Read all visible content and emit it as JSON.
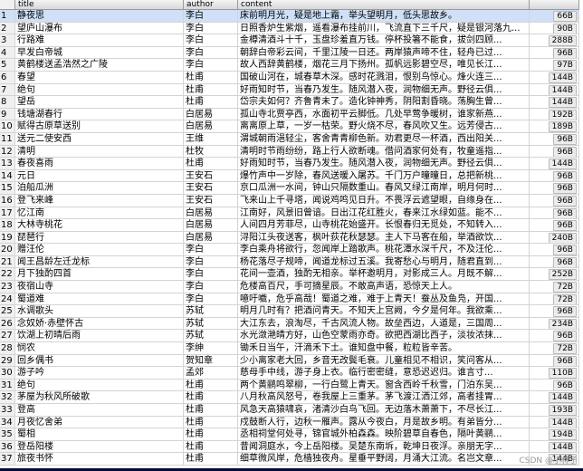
{
  "columns": {
    "title": "title",
    "author": "author",
    "content": "content"
  },
  "rows": [
    {
      "n": "1",
      "title": "静夜思",
      "author": "李白",
      "content": "床前明月光，疑是地上霜，举头望明月，低头思故乡。",
      "size": "66B"
    },
    {
      "n": "2",
      "title": "望庐山瀑布",
      "author": "李白",
      "content": "日照香炉生紫烟，遥看瀑布挂前川，飞流直下三千尺，疑是银河落九...",
      "size": "90B"
    },
    {
      "n": "3",
      "title": "行路难",
      "author": "李白",
      "content": "金樽清酒斗十千，玉盘珍羞直万钱。停杯投箸不能食，拔剑四顾...",
      "size": "288B"
    },
    {
      "n": "4",
      "title": "早发白帝城",
      "author": "李白",
      "content": "朝辞白帝彩云间，千里江陵一日还。两岸猿声啼不住，轻舟已过...",
      "size": "96B"
    },
    {
      "n": "5",
      "title": "黄鹤楼送孟浩然之广陵",
      "author": "李白",
      "content": "故人西辞黄鹤楼，烟花三月下扬州。孤帆远影碧空尽，唯见长江...",
      "size": "97B"
    },
    {
      "n": "6",
      "title": "春望",
      "author": "杜甫",
      "content": "国破山河在，城春草木深。感时花溅泪，恨别鸟惊心。烽火连三...",
      "size": "144B"
    },
    {
      "n": "7",
      "title": "绝句",
      "author": "杜甫",
      "content": "好雨知时节，当春乃发生。随风潜入夜，润物细无声。野径云俱...",
      "size": "144B"
    },
    {
      "n": "8",
      "title": "望岳",
      "author": "杜甫",
      "content": "岱宗夫如何？齐鲁青未了。造化钟神秀，阴阳割昏晓。荡胸生曾...",
      "size": "144B"
    },
    {
      "n": "9",
      "title": "钱塘湖春行",
      "author": "白居易",
      "content": "孤山寺北贾亭西，水面初平云脚低。几处早莺争暖树，谁家新燕...",
      "size": "192B"
    },
    {
      "n": "10",
      "title": "赋得古原草送别",
      "author": "白居易",
      "content": "离离原上草，一岁一枯荣。野火烧不尽，春风吹又生。远芳侵古...",
      "size": "189B"
    },
    {
      "n": "11",
      "title": "送元二使安西",
      "author": "王维",
      "content": "渭城朝雨浥轻尘，客舍青青柳色新。劝君更尽一杯酒，西出阳关...",
      "size": "96B"
    },
    {
      "n": "12",
      "title": "清明",
      "author": "杜牧",
      "content": "清明时节雨纷纷，路上行人欲断魂。借问酒家何处有，牧童遥指...",
      "size": "96B"
    },
    {
      "n": "13",
      "title": "春夜喜雨",
      "author": "杜甫",
      "content": "好雨知时节，当春乃发生。随风潜入夜，润物细无声。野径云俱...",
      "size": "144B"
    },
    {
      "n": "14",
      "title": "元日",
      "author": "王安石",
      "content": "爆竹声中一岁除，春风送暖入屠苏。千门万户曈曈日，总把新桃...",
      "size": "96B"
    },
    {
      "n": "15",
      "title": "泊船瓜洲",
      "author": "王安石",
      "content": "京口瓜洲一水间，钟山只隔数重山。春风又绿江南岸，明月何时...",
      "size": "96B"
    },
    {
      "n": "16",
      "title": "登飞来峰",
      "author": "王安石",
      "content": "飞来山上千寻塔，闻说鸡鸣见日升。不畏浮云遮望眼，自缘身在...",
      "size": "96B"
    },
    {
      "n": "17",
      "title": "忆江南",
      "author": "白居易",
      "content": "江南好，风景旧曾谙。日出江花红胜火，春来江水绿如蓝。能不...",
      "size": "96B"
    },
    {
      "n": "18",
      "title": "大林寺桃花",
      "author": "白居易",
      "content": "人间四月芳菲尽，山寺桃花始盛开。长恨春归无觅处，不知转入...",
      "size": "96B"
    },
    {
      "n": "19",
      "title": "琵琶行",
      "author": "白居易",
      "content": "浔阳江头夜送客，枫叶荻花秋瑟瑟。主人下马客在船，举酒欲饮...",
      "size": "240B"
    },
    {
      "n": "20",
      "title": "赠汪伦",
      "author": "李白",
      "content": "李白乘舟将欲行，忽闻岸上踏歌声。桃花潭水深千尺，不及汪伦...",
      "size": "96B"
    },
    {
      "n": "21",
      "title": "闻王昌龄左迁龙标",
      "author": "李白",
      "content": "杨花落尽子规啼，闻道龙标过五溪。我寄愁心与明月，随君直到...",
      "size": "96B"
    },
    {
      "n": "22",
      "title": "月下独酌四首",
      "author": "李白",
      "content": "花间一壶酒，独酌无相亲。举杯邀明月，对影成三人。月既不解...",
      "size": "252B"
    },
    {
      "n": "23",
      "title": "夜宿山寺",
      "author": "李白",
      "content": "危楼高百尺，手可摘星辰。不敢高声语，恐惊天上人。",
      "size": "72B"
    },
    {
      "n": "24",
      "title": "蜀道难",
      "author": "李白",
      "content": "噫吁嚱，危乎高哉！蜀道之难，难于上青天！蚕丛及鱼凫，开国...",
      "size": "72B"
    },
    {
      "n": "25",
      "title": "水调歌头",
      "author": "苏轼",
      "content": "明月几时有？把酒问青天。不知天上宫阙，今夕是何年。我欲乘...",
      "size": "96B"
    },
    {
      "n": "26",
      "title": "念奴娇·赤壁怀古",
      "author": "苏轼",
      "content": "大江东去，浪淘尽，千古风流人物。故垒西边，人道是，三国周...",
      "size": "234B"
    },
    {
      "n": "27",
      "title": "饮湖上初晴后雨",
      "author": "苏轼",
      "content": "水光潋滟晴方好，山色空蒙雨亦奇。欲把西湖比西子，淡妆浓抹...",
      "size": "96B"
    },
    {
      "n": "28",
      "title": "悯农",
      "author": "李绅",
      "content": "锄禾日当午，汗滴禾下土。谁知盘中餐，粒粒皆辛苦。",
      "size": "72B"
    },
    {
      "n": "29",
      "title": "回乡偶书",
      "author": "贺知章",
      "content": "少小离家老大回，乡音无改鬓毛衰。儿童相见不相识，笑问客从...",
      "size": "96B"
    },
    {
      "n": "30",
      "title": "游子吟",
      "author": "孟郊",
      "content": "慈母手中线，游子身上衣。临行密密缝，意恐迟迟归。谁言寸...",
      "size": "110B"
    },
    {
      "n": "31",
      "title": "绝句",
      "author": "杜甫",
      "content": "两个黄鹂鸣翠柳，一行白鹭上青天。窗含西岭千秋雪，门泊东吴...",
      "size": "96B"
    },
    {
      "n": "32",
      "title": "茅屋为秋风所破歌",
      "author": "杜甫",
      "content": "八月秋高风怒号，卷我屋上三重茅。茅飞渡江洒江郊，高者挂胃...",
      "size": "144B"
    },
    {
      "n": "33",
      "title": "登高",
      "author": "杜甫",
      "content": "风急天高猿啸哀，渚清沙白鸟飞回。无边落木萧萧下，不尽长江...",
      "size": "193B"
    },
    {
      "n": "34",
      "title": "月夜忆舍弟",
      "author": "杜甫",
      "content": "戍鼓断人行，边秋一雁声。露从今夜白，月是故乡明。有弟皆分...",
      "size": "144B"
    },
    {
      "n": "35",
      "title": "蜀相",
      "author": "杜甫",
      "content": "丞相祠堂何处寻，锦官城外柏森森。映阶碧草自春色，隔叶黄鹂...",
      "size": "194B"
    },
    {
      "n": "36",
      "title": "登岳阳楼",
      "author": "杜甫",
      "content": "昔闻洞庭水，今上岳阳楼。吴楚东南坼，乾坤日夜浮。亲朋无字...",
      "size": "144B"
    },
    {
      "n": "37",
      "title": "旅夜书怀",
      "author": "杜甫",
      "content": "细草微风岸，危樯独夜舟。星垂平野阔，月涌大江流。名岂文章...",
      "size": "144B"
    }
  ],
  "watermark": "CSDN @小林子",
  "colors": {
    "selected_row": "#cfe0f7",
    "header": "#e0e0e0"
  }
}
